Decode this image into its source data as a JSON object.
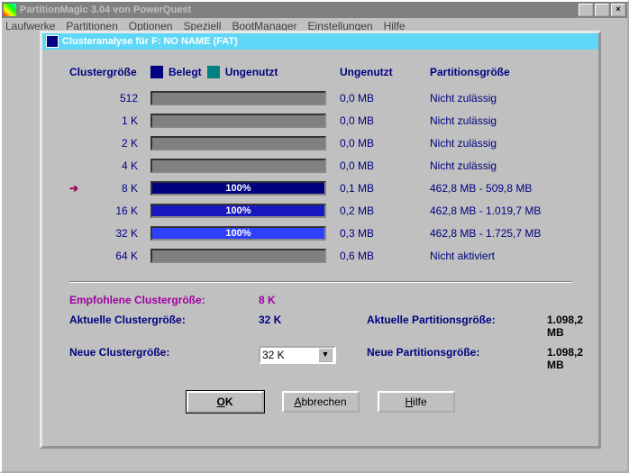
{
  "parentWindow": {
    "title": "PartitionMagic 3.04 von PowerQuest"
  },
  "menubar": {
    "items": [
      "Laufwerke",
      "Partitionen",
      "Optionen",
      "Speziell",
      "BootManager",
      "Einstellungen",
      "Hilfe"
    ]
  },
  "dialog": {
    "title": "Clusteranalyse für  F: NO NAME (FAT)"
  },
  "headers": {
    "cluster": "Clustergröße",
    "belegt": "Belegt",
    "ungenutzt": "Ungenutzt",
    "ungenutzt2": "Ungenutzt",
    "partsize": "Partitionsgröße"
  },
  "rows": [
    {
      "size": "512",
      "pct": 0,
      "fill": "#808080",
      "label": "",
      "ungenutzt": "0,0 MB",
      "partsize": "Nicht zulässig",
      "arrow": false
    },
    {
      "size": "1 K",
      "pct": 0,
      "fill": "#808080",
      "label": "",
      "ungenutzt": "0,0 MB",
      "partsize": "Nicht zulässig",
      "arrow": false
    },
    {
      "size": "2 K",
      "pct": 0,
      "fill": "#808080",
      "label": "",
      "ungenutzt": "0,0 MB",
      "partsize": "Nicht zulässig",
      "arrow": false
    },
    {
      "size": "4 K",
      "pct": 0,
      "fill": "#808080",
      "label": "",
      "ungenutzt": "0,0 MB",
      "partsize": "Nicht zulässig",
      "arrow": false
    },
    {
      "size": "8 K",
      "pct": 100,
      "fill": "#000080",
      "label": "100%",
      "ungenutzt": "0,1 MB",
      "partsize": "462,8 MB - 509,8 MB",
      "arrow": true
    },
    {
      "size": "16 K",
      "pct": 100,
      "fill": "#1818c0",
      "label": "100%",
      "ungenutzt": "0,2 MB",
      "partsize": "462,8 MB - 1.019,7 MB",
      "arrow": false
    },
    {
      "size": "32 K",
      "pct": 100,
      "fill": "#3040ff",
      "label": "100%",
      "ungenutzt": "0,3 MB",
      "partsize": "462,8 MB - 1.725,7 MB",
      "arrow": false
    },
    {
      "size": "64 K",
      "pct": 0,
      "fill": "#808080",
      "label": "",
      "ungenutzt": "0,6 MB",
      "partsize": "Nicht aktiviert",
      "arrow": false
    }
  ],
  "info": {
    "empfLabel": "Empfohlene Clustergröße:",
    "empfVal": "8 K",
    "aktLabel": "Aktuelle Clustergröße:",
    "aktVal": "32 K",
    "aktPartLabel": "Aktuelle Partitionsgröße:",
    "aktPartVal": "1.098,2 MB",
    "neueLabel": "Neue Clustergröße:",
    "neueVal": "32 K",
    "neuePartLabel": "Neue Partitionsgröße:",
    "neuePartVal": "1.098,2 MB"
  },
  "buttons": {
    "ok": "OK",
    "cancel": "Abbrechen",
    "help": "Hilfe"
  }
}
